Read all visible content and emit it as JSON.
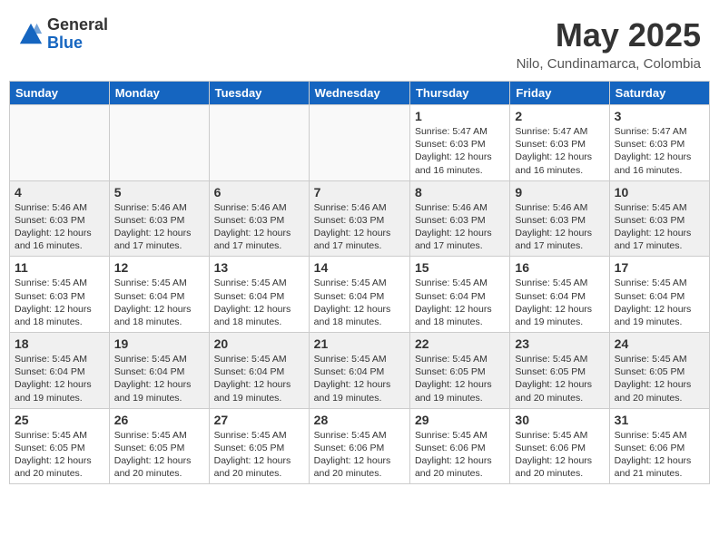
{
  "header": {
    "logo_general": "General",
    "logo_blue": "Blue",
    "month_year": "May 2025",
    "location": "Nilo, Cundinamarca, Colombia"
  },
  "days_of_week": [
    "Sunday",
    "Monday",
    "Tuesday",
    "Wednesday",
    "Thursday",
    "Friday",
    "Saturday"
  ],
  "weeks": [
    [
      {
        "day": "",
        "info": ""
      },
      {
        "day": "",
        "info": ""
      },
      {
        "day": "",
        "info": ""
      },
      {
        "day": "",
        "info": ""
      },
      {
        "day": "1",
        "info": "Sunrise: 5:47 AM\nSunset: 6:03 PM\nDaylight: 12 hours\nand 16 minutes."
      },
      {
        "day": "2",
        "info": "Sunrise: 5:47 AM\nSunset: 6:03 PM\nDaylight: 12 hours\nand 16 minutes."
      },
      {
        "day": "3",
        "info": "Sunrise: 5:47 AM\nSunset: 6:03 PM\nDaylight: 12 hours\nand 16 minutes."
      }
    ],
    [
      {
        "day": "4",
        "info": "Sunrise: 5:46 AM\nSunset: 6:03 PM\nDaylight: 12 hours\nand 16 minutes."
      },
      {
        "day": "5",
        "info": "Sunrise: 5:46 AM\nSunset: 6:03 PM\nDaylight: 12 hours\nand 17 minutes."
      },
      {
        "day": "6",
        "info": "Sunrise: 5:46 AM\nSunset: 6:03 PM\nDaylight: 12 hours\nand 17 minutes."
      },
      {
        "day": "7",
        "info": "Sunrise: 5:46 AM\nSunset: 6:03 PM\nDaylight: 12 hours\nand 17 minutes."
      },
      {
        "day": "8",
        "info": "Sunrise: 5:46 AM\nSunset: 6:03 PM\nDaylight: 12 hours\nand 17 minutes."
      },
      {
        "day": "9",
        "info": "Sunrise: 5:46 AM\nSunset: 6:03 PM\nDaylight: 12 hours\nand 17 minutes."
      },
      {
        "day": "10",
        "info": "Sunrise: 5:45 AM\nSunset: 6:03 PM\nDaylight: 12 hours\nand 17 minutes."
      }
    ],
    [
      {
        "day": "11",
        "info": "Sunrise: 5:45 AM\nSunset: 6:03 PM\nDaylight: 12 hours\nand 18 minutes."
      },
      {
        "day": "12",
        "info": "Sunrise: 5:45 AM\nSunset: 6:04 PM\nDaylight: 12 hours\nand 18 minutes."
      },
      {
        "day": "13",
        "info": "Sunrise: 5:45 AM\nSunset: 6:04 PM\nDaylight: 12 hours\nand 18 minutes."
      },
      {
        "day": "14",
        "info": "Sunrise: 5:45 AM\nSunset: 6:04 PM\nDaylight: 12 hours\nand 18 minutes."
      },
      {
        "day": "15",
        "info": "Sunrise: 5:45 AM\nSunset: 6:04 PM\nDaylight: 12 hours\nand 18 minutes."
      },
      {
        "day": "16",
        "info": "Sunrise: 5:45 AM\nSunset: 6:04 PM\nDaylight: 12 hours\nand 19 minutes."
      },
      {
        "day": "17",
        "info": "Sunrise: 5:45 AM\nSunset: 6:04 PM\nDaylight: 12 hours\nand 19 minutes."
      }
    ],
    [
      {
        "day": "18",
        "info": "Sunrise: 5:45 AM\nSunset: 6:04 PM\nDaylight: 12 hours\nand 19 minutes."
      },
      {
        "day": "19",
        "info": "Sunrise: 5:45 AM\nSunset: 6:04 PM\nDaylight: 12 hours\nand 19 minutes."
      },
      {
        "day": "20",
        "info": "Sunrise: 5:45 AM\nSunset: 6:04 PM\nDaylight: 12 hours\nand 19 minutes."
      },
      {
        "day": "21",
        "info": "Sunrise: 5:45 AM\nSunset: 6:04 PM\nDaylight: 12 hours\nand 19 minutes."
      },
      {
        "day": "22",
        "info": "Sunrise: 5:45 AM\nSunset: 6:05 PM\nDaylight: 12 hours\nand 19 minutes."
      },
      {
        "day": "23",
        "info": "Sunrise: 5:45 AM\nSunset: 6:05 PM\nDaylight: 12 hours\nand 20 minutes."
      },
      {
        "day": "24",
        "info": "Sunrise: 5:45 AM\nSunset: 6:05 PM\nDaylight: 12 hours\nand 20 minutes."
      }
    ],
    [
      {
        "day": "25",
        "info": "Sunrise: 5:45 AM\nSunset: 6:05 PM\nDaylight: 12 hours\nand 20 minutes."
      },
      {
        "day": "26",
        "info": "Sunrise: 5:45 AM\nSunset: 6:05 PM\nDaylight: 12 hours\nand 20 minutes."
      },
      {
        "day": "27",
        "info": "Sunrise: 5:45 AM\nSunset: 6:05 PM\nDaylight: 12 hours\nand 20 minutes."
      },
      {
        "day": "28",
        "info": "Sunrise: 5:45 AM\nSunset: 6:06 PM\nDaylight: 12 hours\nand 20 minutes."
      },
      {
        "day": "29",
        "info": "Sunrise: 5:45 AM\nSunset: 6:06 PM\nDaylight: 12 hours\nand 20 minutes."
      },
      {
        "day": "30",
        "info": "Sunrise: 5:45 AM\nSunset: 6:06 PM\nDaylight: 12 hours\nand 20 minutes."
      },
      {
        "day": "31",
        "info": "Sunrise: 5:45 AM\nSunset: 6:06 PM\nDaylight: 12 hours\nand 21 minutes."
      }
    ]
  ]
}
